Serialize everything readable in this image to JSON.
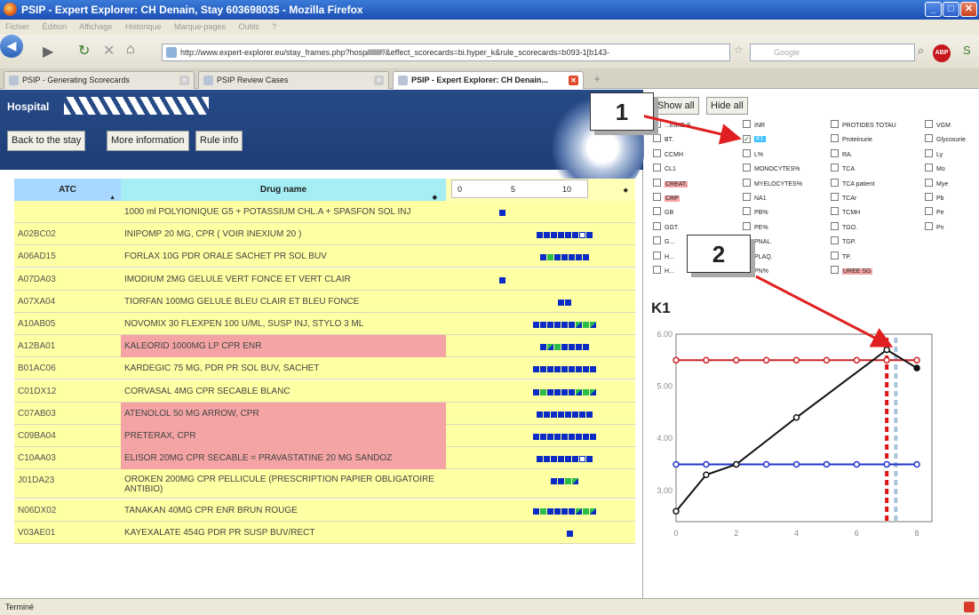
{
  "window": {
    "title": "PSIP - Expert Explorer: CH Denain, Stay 603698035 - Mozilla Firefox"
  },
  "menu": [
    "Fichier",
    "Édition",
    "Affichage",
    "Historique",
    "Marque-pages",
    "Outils",
    "?"
  ],
  "nav": {
    "url": "http://www.expert-explorer.eu/stay_frames.php?hosp⁄⁄⁄⁄⁄⁄⁄⁄⁄⁄⁄⁄/&effect_scorecards=bi.hyper_k&rule_scorecards=b093-1[b143-",
    "search_placeholder": "Google"
  },
  "tabs": [
    {
      "label": "PSIP - Generating Scorecards",
      "active": false
    },
    {
      "label": "PSIP Review Cases",
      "active": false
    },
    {
      "label": "PSIP - Expert Explorer: CH Denain...",
      "active": true
    }
  ],
  "header": {
    "hospital_label": "Hospital",
    "back_button": "Back to the stay",
    "more_button": "More information",
    "rule_button": "Rule info"
  },
  "table": {
    "col_atc": "ATC",
    "col_drug": "Drug name",
    "scale": [
      "0",
      "5",
      "10"
    ],
    "rows": [
      {
        "atc": "",
        "drug": "1000 ml POLYIONIQUE G5 + POTASSIUM CHL.A + SPASFON SOL INJ",
        "alert": false,
        "marks": "b"
      },
      {
        "atc": "A02BC02",
        "drug": "INIPOMP 20 MG, CPR ( VOIR INEXIUM 20 )",
        "alert": false,
        "marks": "bbbbbbwb"
      },
      {
        "atc": "A06AD15",
        "drug": "FORLAX 10G PDR ORALE SACHET PR SOL BUV",
        "alert": false,
        "marks": "bgbbbbb"
      },
      {
        "atc": "A07DA03",
        "drug": "IMODIUM 2MG GELULE VERT FONCE ET VERT CLAIR",
        "alert": false,
        "marks": "b"
      },
      {
        "atc": "A07XA04",
        "drug": "TIORFAN 100MG GELULE BLEU CLAIR ET BLEU FONCE",
        "alert": false,
        "marks": "bb"
      },
      {
        "atc": "A10AB05",
        "drug": "NOVOMIX 30 FLEXPEN 100 U/ML, SUSP INJ, STYLO 3 ML",
        "alert": false,
        "marks": "bbbbbbxgx"
      },
      {
        "atc": "A12BA01",
        "drug": "KALEORID 1000MG LP CPR ENR",
        "alert": true,
        "marks": "bxgbbbb"
      },
      {
        "atc": "B01AC06",
        "drug": "KARDEGIC 75 MG, PDR PR SOL BUV, SACHET",
        "alert": false,
        "marks": "bbbbbbbbb"
      },
      {
        "atc": "C01DX12",
        "drug": "CORVASAL 4MG CPR SECABLE BLANC",
        "alert": false,
        "marks": "bgbbbbxgx"
      },
      {
        "atc": "C07AB03",
        "drug": "ATENOLOL 50 MG ARROW, CPR",
        "alert": true,
        "marks": "bbbbbbbb"
      },
      {
        "atc": "C09BA04",
        "drug": "PRETERAX, CPR",
        "alert": true,
        "marks": "bbbbbbbbb"
      },
      {
        "atc": "C10AA03",
        "drug": "ELISOR 20MG CPR SECABLE = PRAVASTATINE 20 MG SANDOZ",
        "alert": true,
        "marks": "bbbbbbwb"
      },
      {
        "atc": "J01DA23",
        "drug": "OROKEN 200MG CPR PELLICULE (PRESCRIPTION PAPIER OBLIGATOIRE ANTIBIO)",
        "alert": false,
        "marks": "bbgx"
      },
      {
        "atc": "N06DX02",
        "drug": "TANAKAN 40MG CPR ENR BRUN ROUGE",
        "alert": false,
        "marks": "bgbbbbxgx"
      },
      {
        "atc": "V03AE01",
        "drug": "KAYEXALATE 454G PDR PR SUSP BUV/RECT",
        "alert": false,
        "marks": "b"
      }
    ]
  },
  "right": {
    "show_all": "Show all",
    "hide_all": "Hide all",
    "callout1": "1",
    "callout2": "2",
    "lab_columns": [
      [
        {
          "l": "...EMIE S",
          "on": false,
          "hl": ""
        },
        {
          "l": "BT.",
          "on": false,
          "hl": ""
        },
        {
          "l": "CCMH",
          "on": false,
          "hl": ""
        },
        {
          "l": "CL1",
          "on": false,
          "hl": ""
        },
        {
          "l": "CREAT.",
          "on": false,
          "hl": "red"
        },
        {
          "l": "CRP",
          "on": false,
          "hl": "red"
        },
        {
          "l": "GB",
          "on": false,
          "hl": ""
        },
        {
          "l": "GGT.",
          "on": false,
          "hl": ""
        },
        {
          "l": "G...",
          "on": false,
          "hl": ""
        },
        {
          "l": "H...",
          "on": false,
          "hl": ""
        },
        {
          "l": "H...",
          "on": false,
          "hl": ""
        }
      ],
      [
        {
          "l": "INR",
          "on": false,
          "hl": ""
        },
        {
          "l": "K1",
          "on": true,
          "hl": "blue"
        },
        {
          "l": "L%",
          "on": false,
          "hl": ""
        },
        {
          "l": "MONOCYTES%",
          "on": false,
          "hl": ""
        },
        {
          "l": "MYELOCYTES%",
          "on": false,
          "hl": ""
        },
        {
          "l": "NA1",
          "on": false,
          "hl": ""
        },
        {
          "l": "PB%",
          "on": false,
          "hl": ""
        },
        {
          "l": "PE%",
          "on": false,
          "hl": ""
        },
        {
          "l": "PNAL.",
          "on": false,
          "hl": ""
        },
        {
          "l": "PLAQ.",
          "on": false,
          "hl": ""
        },
        {
          "l": "PN%",
          "on": false,
          "hl": ""
        }
      ],
      [
        {
          "l": "PROTIDES TOTAU",
          "on": false,
          "hl": ""
        },
        {
          "l": "Proteinurie",
          "on": false,
          "hl": ""
        },
        {
          "l": "RA.",
          "on": false,
          "hl": ""
        },
        {
          "l": "TCA",
          "on": false,
          "hl": ""
        },
        {
          "l": "TCA patient",
          "on": false,
          "hl": ""
        },
        {
          "l": "TCAr",
          "on": false,
          "hl": ""
        },
        {
          "l": "TCMH",
          "on": false,
          "hl": ""
        },
        {
          "l": "TGO.",
          "on": false,
          "hl": ""
        },
        {
          "l": "TGP.",
          "on": false,
          "hl": ""
        },
        {
          "l": "TP.",
          "on": false,
          "hl": ""
        },
        {
          "l": "UREE SG",
          "on": false,
          "hl": "red"
        }
      ],
      [
        {
          "l": "VGM",
          "on": false,
          "hl": ""
        },
        {
          "l": "Glycosurie",
          "on": false,
          "hl": ""
        },
        {
          "l": "Ly",
          "on": false,
          "hl": ""
        },
        {
          "l": "Mo",
          "on": false,
          "hl": ""
        },
        {
          "l": "Mye",
          "on": false,
          "hl": ""
        },
        {
          "l": "Pb",
          "on": false,
          "hl": ""
        },
        {
          "l": "Pe",
          "on": false,
          "hl": ""
        },
        {
          "l": "Pn",
          "on": false,
          "hl": ""
        }
      ]
    ]
  },
  "chart_data": {
    "type": "line",
    "title": "K1",
    "xlim": [
      0,
      8.5
    ],
    "ylim": [
      2.4,
      6.0
    ],
    "xticks": [
      "0",
      "2",
      "4",
      "6",
      "8"
    ],
    "yticks": [
      "3.00",
      "4.00",
      "5.00",
      "6.00"
    ],
    "grid": false,
    "series": [
      {
        "color": "#cc2222",
        "x": [
          0,
          1,
          2,
          3,
          4,
          5,
          6,
          7,
          8
        ],
        "y": [
          5.5,
          5.5,
          5.5,
          5.5,
          5.5,
          5.5,
          5.5,
          5.5,
          5.5
        ]
      },
      {
        "color": "#2233cc",
        "x": [
          0,
          1,
          2,
          3,
          4,
          5,
          6,
          7,
          8
        ],
        "y": [
          3.5,
          3.5,
          3.5,
          3.5,
          3.5,
          3.5,
          3.5,
          3.5,
          3.5
        ]
      },
      {
        "color": "#111111",
        "x": [
          0,
          1,
          2,
          4,
          7,
          8
        ],
        "y": [
          2.6,
          3.3,
          3.5,
          4.4,
          5.7,
          5.35
        ]
      }
    ],
    "markers_x": [
      {
        "x": 7.0,
        "color": "#dd1111"
      },
      {
        "x": 7.3,
        "color": "#a8c4dc"
      }
    ]
  },
  "status": {
    "text": "Terminé"
  }
}
